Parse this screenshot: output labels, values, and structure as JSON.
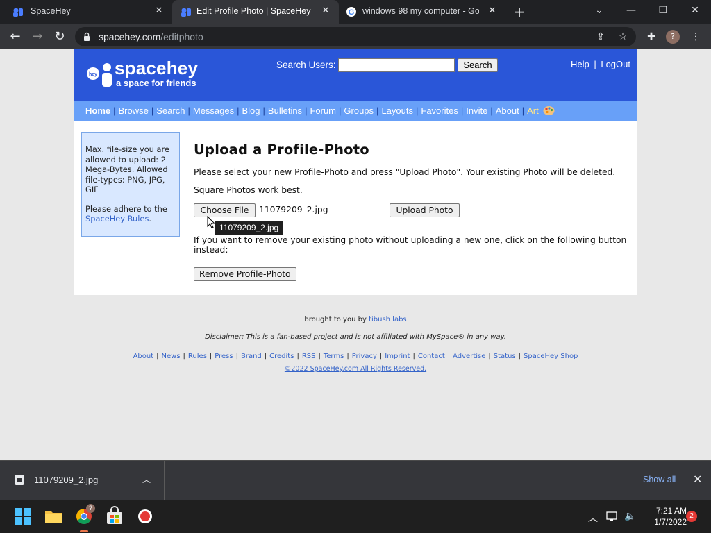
{
  "browser": {
    "tabs": [
      {
        "title": "SpaceHey",
        "active": false
      },
      {
        "title": "Edit Profile Photo | SpaceHey",
        "active": true
      },
      {
        "title": "windows 98 my computer - Goo",
        "active": false
      }
    ],
    "url_domain": "spacehey.com",
    "url_path": "/editphoto",
    "profile_initial": "?"
  },
  "header": {
    "logo_word": "spacehey",
    "logo_badge": "hey",
    "tagline": "a space for friends",
    "search_label": "Search Users:",
    "search_value": "",
    "search_button": "Search",
    "help": "Help",
    "separator": "|",
    "logout": "LogOut"
  },
  "nav": {
    "items": [
      "Home",
      "Browse",
      "Search",
      "Messages",
      "Blog",
      "Bulletins",
      "Forum",
      "Groups",
      "Layouts",
      "Favorites",
      "Invite",
      "About",
      "Art"
    ]
  },
  "sidebar": {
    "info": "Max. file-size you are allowed to upload: 2 Mega-Bytes. Allowed file-types: PNG, JPG, GIF",
    "rules_prefix": "Please adhere to the",
    "rules_link": "SpaceHey Rules",
    "rules_suffix": "."
  },
  "main": {
    "title": "Upload a Profile-Photo",
    "instructions": "Please select your new Profile-Photo and press \"Upload Photo\". Your existing Photo will be deleted.",
    "tip": "Square Photos work best.",
    "choose_file": "Choose File",
    "selected_file": "11079209_2.jpg",
    "tooltip": "11079209_2.jpg",
    "upload_button": "Upload Photo",
    "remove_note": "If you want to remove your existing photo without uploading a new one, click on the following button instead:",
    "remove_button": "Remove Profile-Photo"
  },
  "footer": {
    "brought_prefix": "brought to you by",
    "brought_link": "tibush labs",
    "disclaimer": "Disclaimer: This is a fan-based project and is not affiliated with MySpace® in any way.",
    "links": [
      "About",
      "News",
      "Rules",
      "Press",
      "Brand",
      "Credits",
      "RSS",
      "Terms",
      "Privacy",
      "Imprint",
      "Contact",
      "Advertise",
      "Status",
      "SpaceHey Shop"
    ],
    "copyright": "©2022 SpaceHey.com All Rights Reserved."
  },
  "downloads": {
    "file": "11079209_2.jpg",
    "show_all": "Show all"
  },
  "taskbar": {
    "chrome_badge": "?",
    "time": "7:21 AM",
    "date": "1/7/2022",
    "notifications": "2"
  },
  "colors": {
    "header_blue": "#2a56d8",
    "nav_blue": "#68a0f8",
    "link_blue": "#3463c9",
    "sidebar_bg": "#d9e8ff"
  }
}
